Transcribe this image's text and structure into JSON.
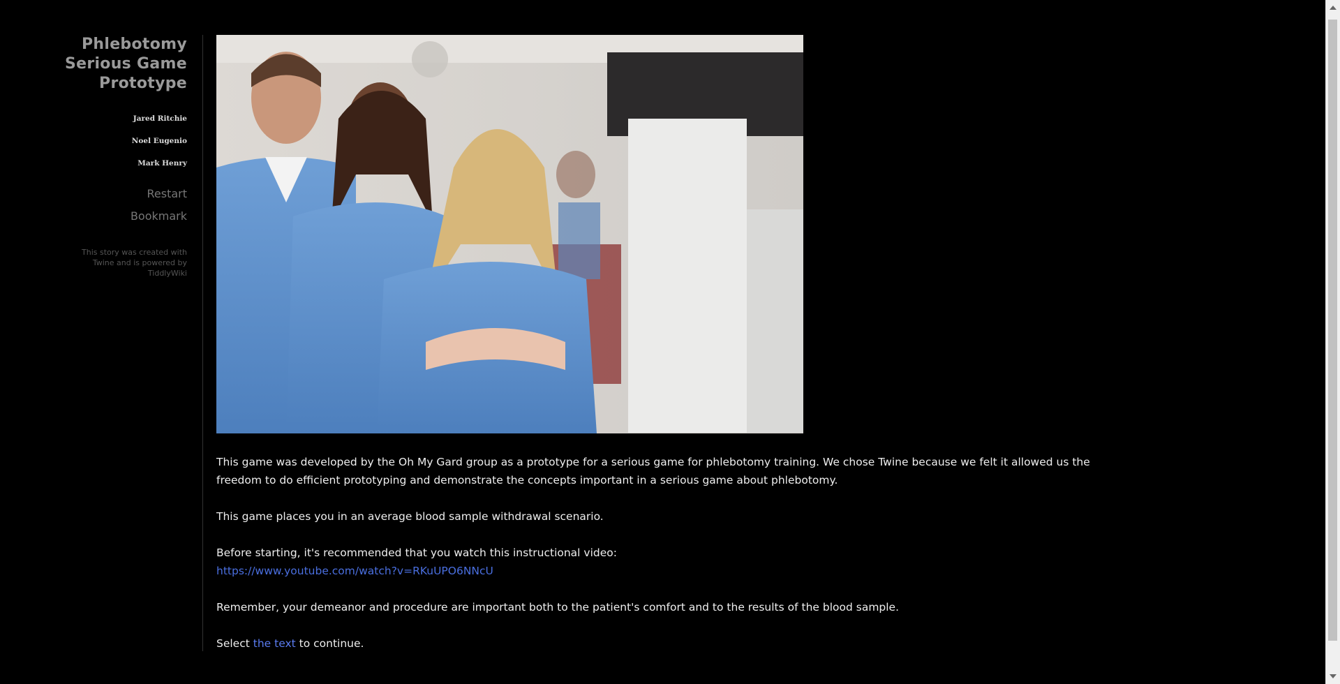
{
  "sidebar": {
    "title_lines": [
      "Phlebotomy",
      "Serious Game",
      "Prototype"
    ],
    "authors": [
      "Jared Ritchie",
      "Noel Eugenio",
      "Mark Henry"
    ],
    "menu": {
      "restart": "Restart",
      "bookmark": "Bookmark"
    },
    "credits": "This story was created with Twine and is powered by TiddlyWiki"
  },
  "passage": {
    "image": {
      "name": "phlebotomy-staff-photo"
    },
    "p1": "This game was developed by the Oh My Gard group as a prototype for a serious game for phlebotomy training. We chose Twine because we felt it allowed us the freedom to do efficient prototyping and demonstrate the concepts important in a serious game about phlebotomy.",
    "p2": "This game places you in an average blood sample withdrawal scenario.",
    "p3": "Before starting, it's recommended that you watch this instructional video:",
    "video_url": "https://www.youtube.com/watch?v=RKuUPO6NNcU",
    "p4": "Remember, your demeanor and procedure are important both to the patient's comfort and to the results of the blood sample.",
    "p5_prefix": "Select ",
    "p5_link": "the text",
    "p5_suffix": " to continue."
  },
  "colors": {
    "background": "#000000",
    "link": "#5a7cf0",
    "title": "#9a9a9a"
  }
}
